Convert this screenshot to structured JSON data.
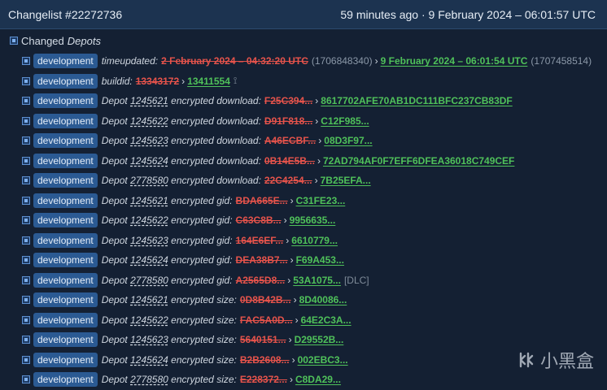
{
  "header": {
    "title": "Changelist #22272736",
    "time": "59 minutes ago · 9 February 2024 – 06:01:57 UTC"
  },
  "section": {
    "label": "Changed",
    "label_em": "Depots"
  },
  "badge_label": "development",
  "rows": [
    {
      "desc_pre": "timeupdated:",
      "depot": "",
      "desc_post": "",
      "old": "2 February 2024 – 04:32:20 UTC",
      "old_note": "(1706848340)",
      "new": "9 February 2024 – 06:01:54 UTC",
      "new_note": "(1707458514)",
      "tag": ""
    },
    {
      "desc_pre": "buildid:",
      "depot": "",
      "desc_post": "",
      "old": "13343172",
      "old_note": "",
      "new": "13411554",
      "new_note": "",
      "tag": "⟟"
    },
    {
      "desc_pre": "Depot",
      "depot": "1245621",
      "desc_post": "encrypted download:",
      "old": "F25C394...",
      "old_note": "",
      "new": "8617702AFE70AB1DC111BFC237CB83DF",
      "new_note": "",
      "tag": ""
    },
    {
      "desc_pre": "Depot",
      "depot": "1245622",
      "desc_post": "encrypted download:",
      "old": "D91F818...",
      "old_note": "",
      "new": "C12F985...",
      "new_note": "",
      "tag": ""
    },
    {
      "desc_pre": "Depot",
      "depot": "1245623",
      "desc_post": "encrypted download:",
      "old": "A46ECBF...",
      "old_note": "",
      "new": "08D3F97...",
      "new_note": "",
      "tag": ""
    },
    {
      "desc_pre": "Depot",
      "depot": "1245624",
      "desc_post": "encrypted download:",
      "old": "0B14E5B...",
      "old_note": "",
      "new": "72AD794AF0F7EFF6DFEA36018C749CEF",
      "new_note": "",
      "tag": ""
    },
    {
      "desc_pre": "Depot",
      "depot": "2778580",
      "desc_post": "encrypted download:",
      "old": "22C4254...",
      "old_note": "",
      "new": "7B25EFA...",
      "new_note": "",
      "tag": ""
    },
    {
      "desc_pre": "Depot",
      "depot": "1245621",
      "desc_post": "encrypted gid:",
      "old": "BDA665E...",
      "old_note": "",
      "new": "C31FE23...",
      "new_note": "",
      "tag": ""
    },
    {
      "desc_pre": "Depot",
      "depot": "1245622",
      "desc_post": "encrypted gid:",
      "old": "C63C8B...",
      "old_note": "",
      "new": "9956635...",
      "new_note": "",
      "tag": ""
    },
    {
      "desc_pre": "Depot",
      "depot": "1245623",
      "desc_post": "encrypted gid:",
      "old": "164E6EF...",
      "old_note": "",
      "new": "6610779...",
      "new_note": "",
      "tag": ""
    },
    {
      "desc_pre": "Depot",
      "depot": "1245624",
      "desc_post": "encrypted gid:",
      "old": "DEA38B7...",
      "old_note": "",
      "new": "F69A453...",
      "new_note": "",
      "tag": ""
    },
    {
      "desc_pre": "Depot",
      "depot": "2778580",
      "desc_post": "encrypted gid:",
      "old": "A2565D8...",
      "old_note": "",
      "new": "53A1075...",
      "new_note": "",
      "tag": "[DLC]"
    },
    {
      "desc_pre": "Depot",
      "depot": "1245621",
      "desc_post": "encrypted size:",
      "old": "0D8B42B...",
      "old_note": "",
      "new": "8D40086...",
      "new_note": "",
      "tag": ""
    },
    {
      "desc_pre": "Depot",
      "depot": "1245622",
      "desc_post": "encrypted size:",
      "old": "FAC5A0D...",
      "old_note": "",
      "new": "64E2C3A...",
      "new_note": "",
      "tag": ""
    },
    {
      "desc_pre": "Depot",
      "depot": "1245623",
      "desc_post": "encrypted size:",
      "old": "5640151...",
      "old_note": "",
      "new": "D29552B...",
      "new_note": "",
      "tag": ""
    },
    {
      "desc_pre": "Depot",
      "depot": "1245624",
      "desc_post": "encrypted size:",
      "old": "B2B2608...",
      "old_note": "",
      "new": "002EBC3...",
      "new_note": "",
      "tag": ""
    },
    {
      "desc_pre": "Depot",
      "depot": "2778580",
      "desc_post": "encrypted size:",
      "old": "E228372...",
      "old_note": "",
      "new": "C8DA29...",
      "new_note": "",
      "tag": ""
    }
  ],
  "watermark": {
    "text": "小黑盒",
    "icon": "heybox-logo-icon"
  }
}
